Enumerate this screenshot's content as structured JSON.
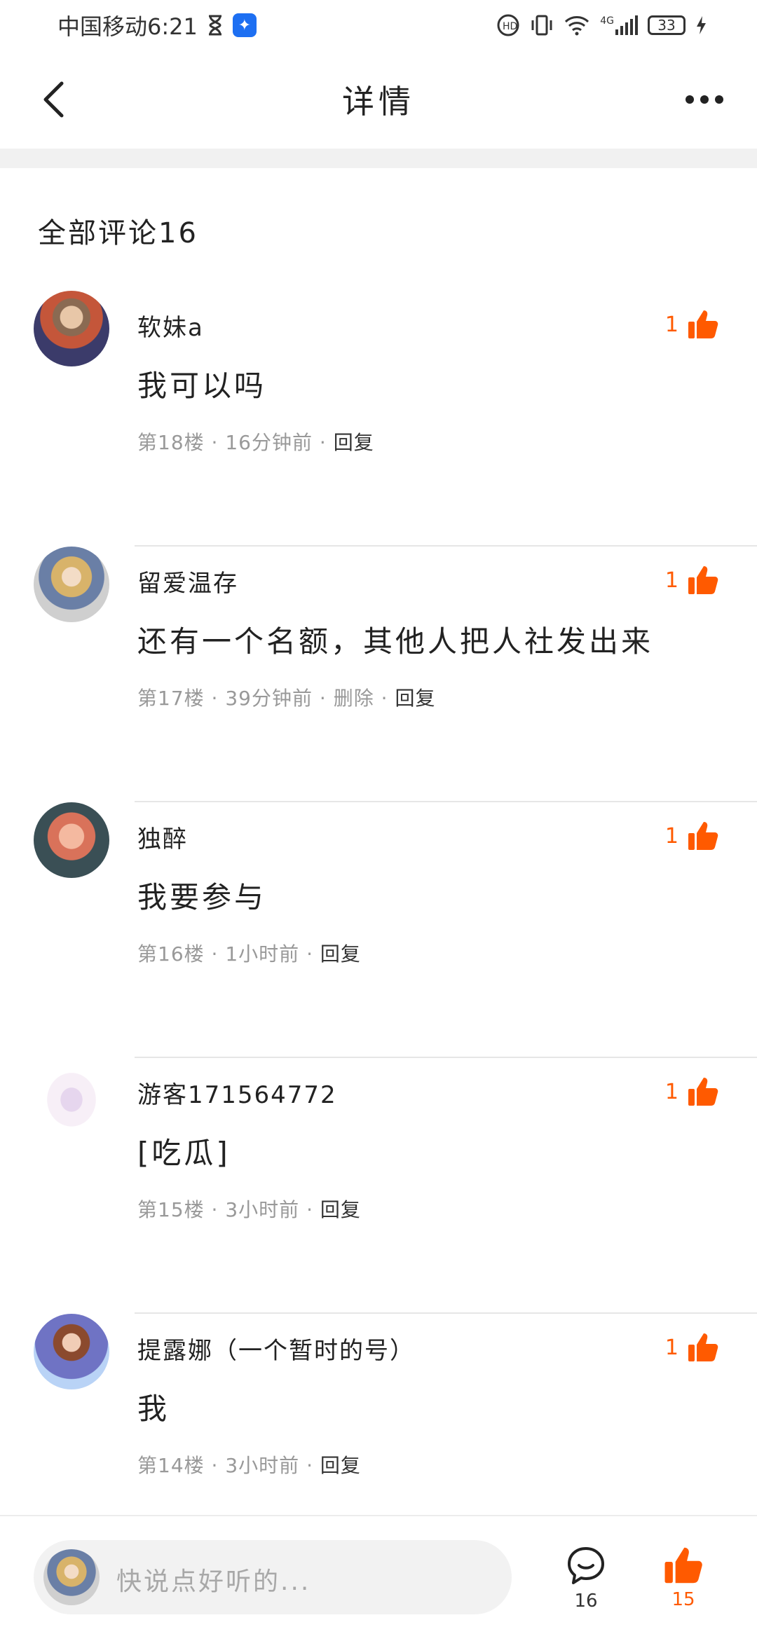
{
  "status_bar": {
    "carrier_time": "中国移动6:21",
    "hourglass_icon": "hourglass-icon",
    "notif_icon": "lightbulb-icon",
    "signal_label": "4G",
    "battery": "33"
  },
  "nav": {
    "title": "详情",
    "back_icon": "chevron-left-icon",
    "more_icon": "more-dots-icon"
  },
  "comments_header": "全部评论16",
  "comments": [
    {
      "name": "软妹a",
      "text": "我可以吗",
      "floor": "第18楼",
      "time": "16分钟前",
      "delete": "",
      "reply": "回复",
      "likes": "1"
    },
    {
      "name": "留爱温存",
      "text": "还有一个名额，其他人把人社发出来",
      "floor": "第17楼",
      "time": "39分钟前",
      "delete": "删除",
      "reply": "回复",
      "likes": "1"
    },
    {
      "name": "独醉",
      "text": "我要参与",
      "floor": "第16楼",
      "time": "1小时前",
      "delete": "",
      "reply": "回复",
      "likes": "1"
    },
    {
      "name": "游客171564772",
      "text": "[吃瓜]",
      "floor": "第15楼",
      "time": "3小时前",
      "delete": "",
      "reply": "回复",
      "likes": "1"
    },
    {
      "name": "提露娜（一个暂时的号）",
      "text": "我",
      "floor": "第14楼",
      "time": "3小时前",
      "delete": "",
      "reply": "回复",
      "likes": "1"
    }
  ],
  "bottom_bar": {
    "placeholder": "快说点好听的...",
    "comment_count": "16",
    "like_count": "15"
  },
  "colors": {
    "accent": "#ff5a00",
    "divider": "#e6e6e6",
    "meta": "#999999"
  }
}
